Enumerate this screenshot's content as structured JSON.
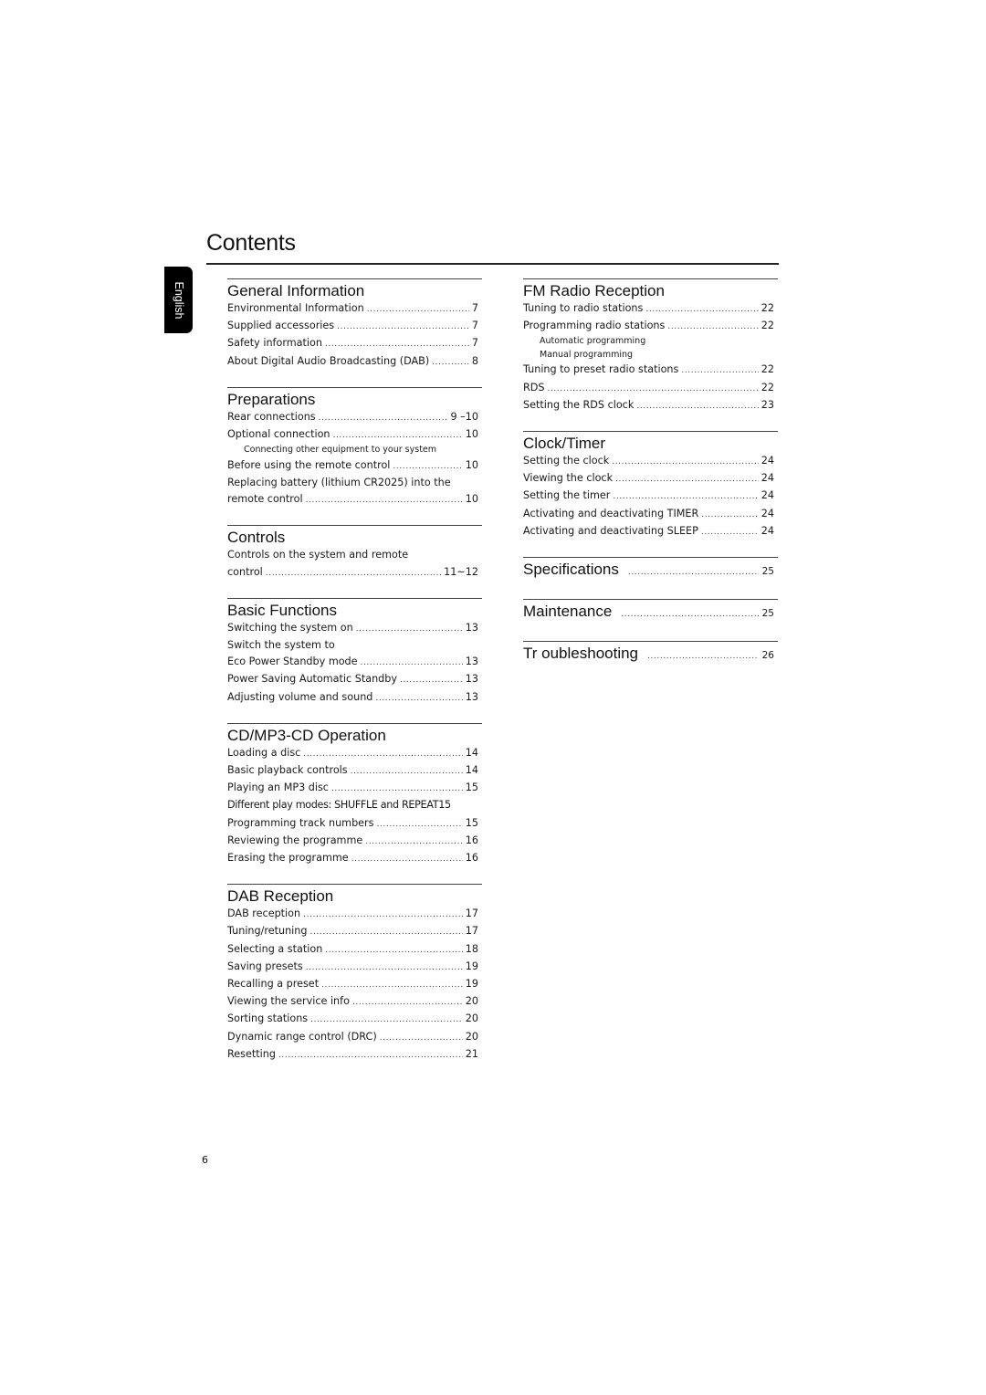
{
  "title": "Contents",
  "language_tab": "English",
  "page_number": "6",
  "left_column": {
    "general": {
      "heading": "General Information",
      "entries": [
        {
          "label": "Environmental Information",
          "page": "7"
        },
        {
          "label": "Supplied accessories",
          "page": "7"
        },
        {
          "label": "Safety information",
          "page": "7"
        },
        {
          "label": "About Digital Audio Broadcasting (DAB)",
          "page": "8"
        }
      ]
    },
    "preparations": {
      "heading": "Preparations",
      "entries": [
        {
          "label": "Rear connections",
          "page": "9 –10"
        },
        {
          "label": "Optional connection",
          "page": "10"
        },
        {
          "label": "Connecting other equipment to your system"
        },
        {
          "label": "Before using the remote control",
          "page": "10"
        },
        {
          "label": "Replacing battery (lithium CR2025) into the"
        },
        {
          "label": "remote control",
          "page": "10"
        }
      ]
    },
    "controls": {
      "heading": "Controls",
      "entries": [
        {
          "label": "Controls on the system and remote"
        },
        {
          "label": "control",
          "page": "11~12"
        }
      ]
    },
    "basic": {
      "heading": "Basic Functions",
      "entries": [
        {
          "label": "Switching the system on",
          "page": "13"
        },
        {
          "label": "Switch the system to"
        },
        {
          "label": "Eco Power Standby mode",
          "page": "13"
        },
        {
          "label": "Power Saving Automatic Standby",
          "page": "13"
        },
        {
          "label": "Adjusting volume and sound",
          "page": "13"
        }
      ]
    },
    "cd": {
      "heading": "CD/MP3-CD Operation",
      "entries": [
        {
          "label": "Loading a disc",
          "page": "14"
        },
        {
          "label": "Basic playback controls",
          "page": "14"
        },
        {
          "label": "Playing an MP3 disc",
          "page": "15"
        },
        {
          "label": "Different play modes: SHUFFLE and REPEAT",
          "page": "15"
        },
        {
          "label": "Programming track numbers",
          "page": "15"
        },
        {
          "label": "Reviewing the programme",
          "page": "16"
        },
        {
          "label": "Erasing the programme",
          "page": "16"
        }
      ]
    },
    "dab": {
      "heading": "DAB Reception",
      "entries": [
        {
          "label": "DAB reception",
          "page": "17"
        },
        {
          "label": "Tuning/retuning",
          "page": "17"
        },
        {
          "label": "Selecting a station",
          "page": "18"
        },
        {
          "label": "Saving presets",
          "page": "19"
        },
        {
          "label": "Recalling a preset",
          "page": "19"
        },
        {
          "label": "Viewing the service info",
          "page": "20"
        },
        {
          "label": "Sorting stations",
          "page": "20"
        },
        {
          "label": "Dynamic range control (DRC)",
          "page": "20"
        },
        {
          "label": "Resetting",
          "page": "21"
        }
      ]
    }
  },
  "right_column": {
    "fm": {
      "heading": "FM Radio Reception",
      "entries": [
        {
          "label": "Tuning to radio stations",
          "page": "22"
        },
        {
          "label": "Programming radio stations",
          "page": "22"
        },
        {
          "label": "Automatic programming"
        },
        {
          "label": "Manual programming"
        },
        {
          "label": "Tuning to preset radio stations",
          "page": "22"
        },
        {
          "label": "RDS",
          "page": "22"
        },
        {
          "label": "Setting the RDS clock",
          "page": "23"
        }
      ]
    },
    "clock": {
      "heading": "Clock/Timer",
      "entries": [
        {
          "label": "Setting the clock",
          "page": "24"
        },
        {
          "label": "Viewing the clock",
          "page": "24"
        },
        {
          "label": "Setting the timer",
          "page": "24"
        },
        {
          "label": "Activating and deactivating TIMER",
          "page": "24"
        },
        {
          "label": "Activating and deactivating SLEEP",
          "page": "24"
        }
      ]
    },
    "specifications": {
      "heading": "Specifications",
      "page": "25"
    },
    "maintenance": {
      "heading": "Maintenance",
      "page": "25"
    },
    "troubleshooting": {
      "heading": "Tr oubleshooting",
      "page": "26"
    }
  }
}
